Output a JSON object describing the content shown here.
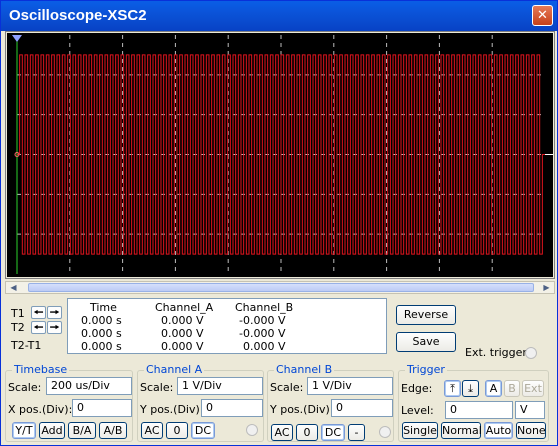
{
  "window": {
    "title": "Oscilloscope-XSC2",
    "close_glyph": "✕"
  },
  "colors": {
    "trace": "#e0141e",
    "screen_bg": "#000000",
    "grid": "#bdbdbd",
    "accent": "#0046d5"
  },
  "scroll": {
    "left_glyph": "◀",
    "right_glyph": "▶"
  },
  "cursors": {
    "t1_label": "T1",
    "t2_label": "T2",
    "t2t1_label": "T2-T1",
    "left_glyph": "🠔",
    "right_glyph": "🠖"
  },
  "readout": {
    "headers": [
      "Time",
      "Channel_A",
      "Channel_B"
    ],
    "rows": [
      [
        "0.000 s",
        "0.000 V",
        "-0.000 V"
      ],
      [
        "0.000 s",
        "0.000 V",
        "-0.000 V"
      ],
      [
        "0.000 s",
        "0.000 V",
        "0.000 V"
      ]
    ]
  },
  "buttons": {
    "reverse": "Reverse",
    "save": "Save",
    "ext_trigger": "Ext. trigger"
  },
  "timebase": {
    "title": "Timebase",
    "scale_label": "Scale:",
    "scale_value": "200 us/Div",
    "xpos_label": "X pos.(Div):",
    "xpos_value": "0",
    "modes": [
      "Y/T",
      "Add",
      "B/A",
      "A/B"
    ]
  },
  "channel_a": {
    "title": "Channel A",
    "scale_label": "Scale:",
    "scale_value": "1  V/Div",
    "ypos_label": "Y pos.(Div):",
    "ypos_value": "0",
    "coupling": [
      "AC",
      "0",
      "DC"
    ]
  },
  "channel_b": {
    "title": "Channel B",
    "scale_label": "Scale:",
    "scale_value": "1  V/Div",
    "ypos_label": "Y pos.(Div):",
    "ypos_value": "0",
    "coupling": [
      "AC",
      "0",
      "DC",
      "-"
    ]
  },
  "trigger": {
    "title": "Trigger",
    "edge_label": "Edge:",
    "edge_rise": "⤒",
    "edge_fall": "⤓",
    "sources": [
      "A",
      "B",
      "Ext"
    ],
    "level_label": "Level:",
    "level_value": "0",
    "level_unit": "V",
    "modes": [
      "Single",
      "Normal",
      "Auto",
      "None"
    ]
  },
  "waveform": {
    "high": 2.5,
    "low": -2.5,
    "start_div": 0.05,
    "end_div": 9.95,
    "cycles": 98
  }
}
